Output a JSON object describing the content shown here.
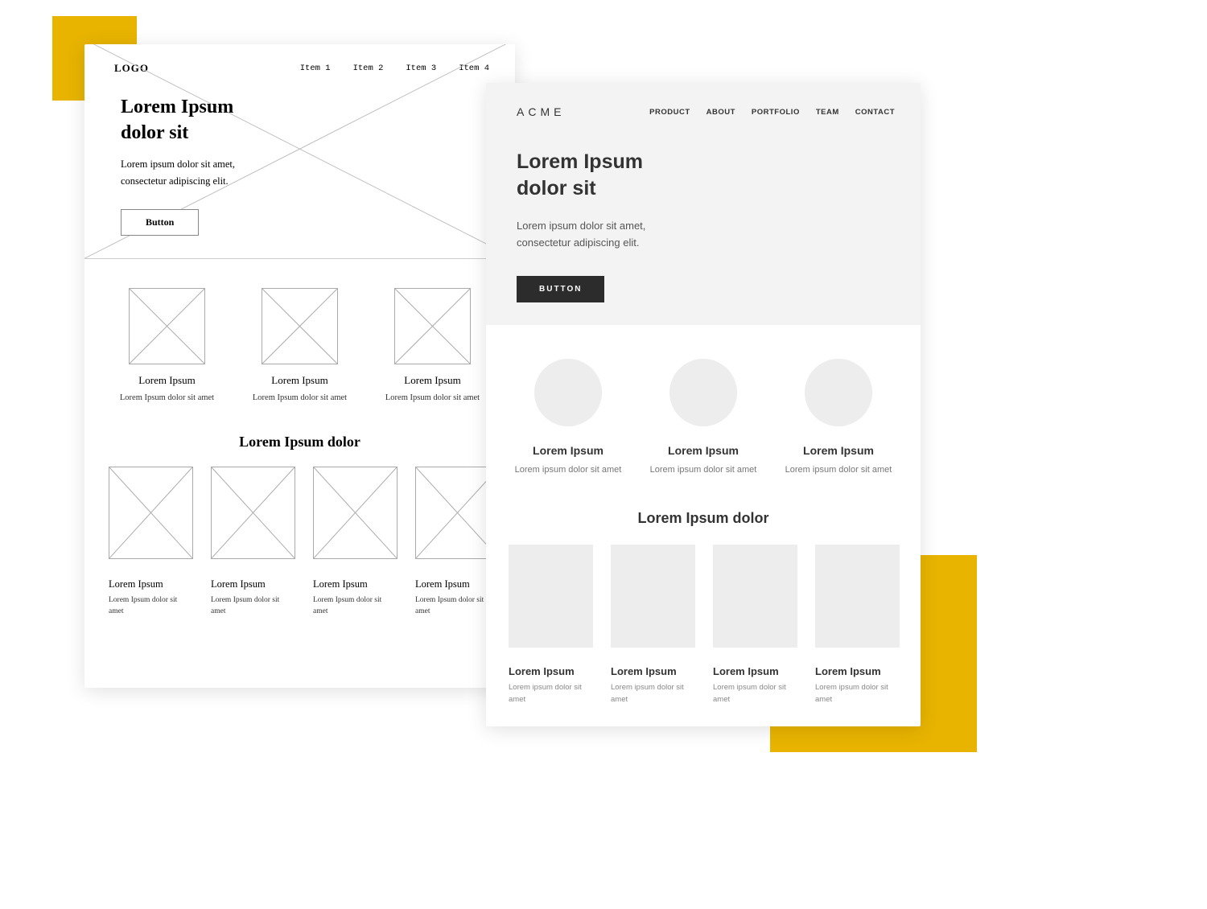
{
  "accent_yellow": "#e8b400",
  "wireframe": {
    "logo": "LOGO",
    "nav": [
      "Item 1",
      "Item 2",
      "Item 3",
      "Item 4"
    ],
    "hero_title": "Lorem Ipsum\ndolor sit",
    "hero_sub": "Lorem ipsum dolor sit amet,\nconsectetur adipiscing elit.",
    "hero_button": "Button",
    "features": [
      {
        "title": "Lorem Ipsum",
        "sub": "Lorem Ipsum dolor sit amet"
      },
      {
        "title": "Lorem Ipsum",
        "sub": "Lorem Ipsum dolor sit amet"
      },
      {
        "title": "Lorem Ipsum",
        "sub": "Lorem Ipsum dolor sit amet"
      }
    ],
    "section2_title": "Lorem Ipsum dolor",
    "portfolio": [
      {
        "title": "Lorem Ipsum",
        "sub": "Lorem Ipsum dolor sit amet"
      },
      {
        "title": "Lorem Ipsum",
        "sub": "Lorem Ipsum dolor sit amet"
      },
      {
        "title": "Lorem Ipsum",
        "sub": "Lorem Ipsum dolor sit amet"
      },
      {
        "title": "Lorem Ipsum",
        "sub": "Lorem Ipsum dolor sit amet"
      }
    ]
  },
  "design": {
    "logo": "ACME",
    "nav": [
      "PRODUCT",
      "ABOUT",
      "PORTFOLIO",
      "TEAM",
      "CONTACT"
    ],
    "hero_title": "Lorem Ipsum\ndolor sit",
    "hero_sub": "Lorem ipsum dolor sit amet,\nconsectetur adipiscing elit.",
    "hero_button": "BUTTON",
    "features": [
      {
        "title": "Lorem Ipsum",
        "sub": "Lorem ipsum dolor sit amet"
      },
      {
        "title": "Lorem Ipsum",
        "sub": "Lorem ipsum dolor sit amet"
      },
      {
        "title": "Lorem Ipsum",
        "sub": "Lorem ipsum dolor sit amet"
      }
    ],
    "section2_title": "Lorem Ipsum dolor",
    "portfolio": [
      {
        "title": "Lorem Ipsum",
        "sub": "Lorem ipsum dolor sit amet"
      },
      {
        "title": "Lorem Ipsum",
        "sub": "Lorem ipsum dolor sit amet"
      },
      {
        "title": "Lorem Ipsum",
        "sub": "Lorem ipsum dolor sit amet"
      },
      {
        "title": "Lorem Ipsum",
        "sub": "Lorem ipsum dolor sit amet"
      }
    ]
  }
}
